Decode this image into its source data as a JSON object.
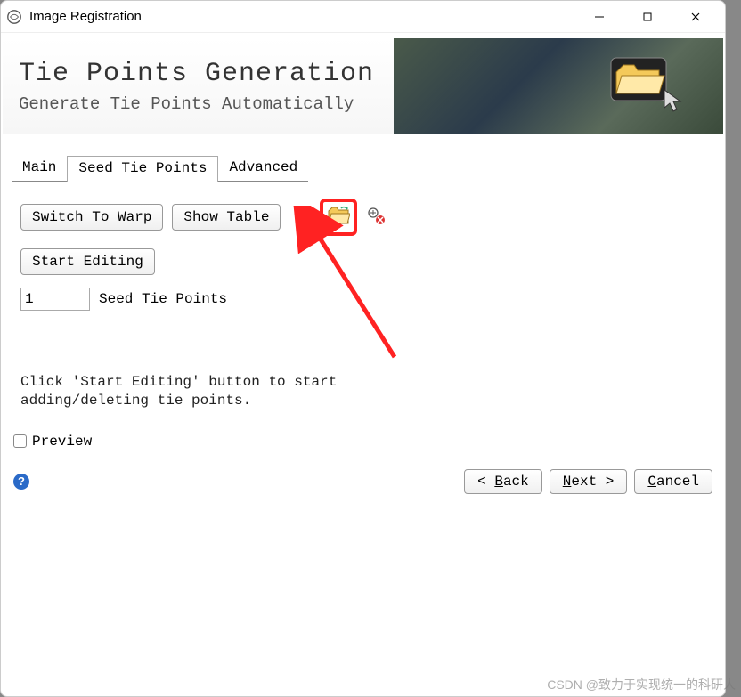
{
  "window": {
    "title": "Image Registration"
  },
  "banner": {
    "title": "Tie Points Generation",
    "subtitle": "Generate Tie Points Automatically"
  },
  "tabs": {
    "main": "Main",
    "seed": "Seed Tie Points",
    "advanced": "Advanced",
    "active": "seed"
  },
  "content": {
    "switch_warp": "Switch To Warp",
    "show_table": "Show Table",
    "start_editing": "Start Editing",
    "seed_count": "1",
    "seed_count_label": "Seed Tie Points",
    "hint": "Click 'Start Editing' button to start adding/deleting tie points."
  },
  "footer": {
    "preview": "Preview",
    "back": "Back",
    "next": "Next",
    "cancel": "Cancel",
    "back_prefix": "< ",
    "next_suffix": " >"
  },
  "watermark": "CSDN @致力于实现统一的科研人"
}
